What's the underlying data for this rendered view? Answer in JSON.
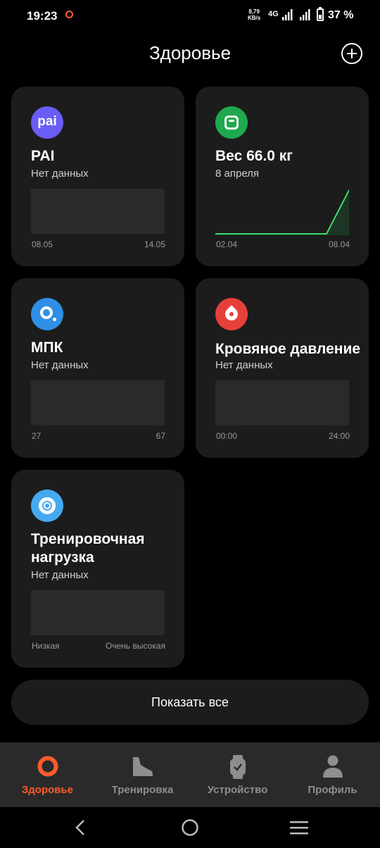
{
  "status_bar": {
    "time": "19:23",
    "net_speed_value": "8,79",
    "net_speed_unit": "KB/s",
    "network_type": "4G",
    "battery_percent": "37 %"
  },
  "header": {
    "title": "Здоровье",
    "add_icon": "plus-circle-icon"
  },
  "cards": {
    "pai": {
      "icon_label": "pai",
      "title": "PAI",
      "subtitle": "Нет данных",
      "axis_start": "08.05",
      "axis_end": "14.05"
    },
    "weight": {
      "title": "Вес 66.0 кг",
      "subtitle": "8 апреля",
      "axis_start": "02.04",
      "axis_end": "08.04"
    },
    "vo2max": {
      "title": "МПК",
      "subtitle": "Нет данных",
      "axis_start": "27",
      "axis_end": "67"
    },
    "blood_pressure": {
      "title": "Кровяное давление",
      "subtitle": "Нет данных",
      "axis_start": "00:00",
      "axis_end": "24:00"
    },
    "training_load": {
      "title_line1": "Тренировочная",
      "title_line2": "нагрузка",
      "subtitle": "Нет данных",
      "axis_start": "Низкая",
      "axis_end": "Очень высокая"
    }
  },
  "chart_data": {
    "type": "line",
    "x_start": "02.04",
    "x_end": "08.04",
    "series_color": "#3ddc6a",
    "description_values": "flat then rising sharply on the last day"
  },
  "show_all_label": "Показать все",
  "bottom_nav": {
    "items": [
      {
        "label": "Здоровье",
        "icon": "health-ring-icon",
        "active": true
      },
      {
        "label": "Тренировка",
        "icon": "shoe-icon",
        "active": false
      },
      {
        "label": "Устройство",
        "icon": "watch-icon",
        "active": false
      },
      {
        "label": "Профиль",
        "icon": "person-icon",
        "active": false
      }
    ]
  },
  "colors": {
    "accent": "#ff5b2c",
    "card_bg": "#1c1c1c",
    "chart_line": "#3ddc6a"
  }
}
